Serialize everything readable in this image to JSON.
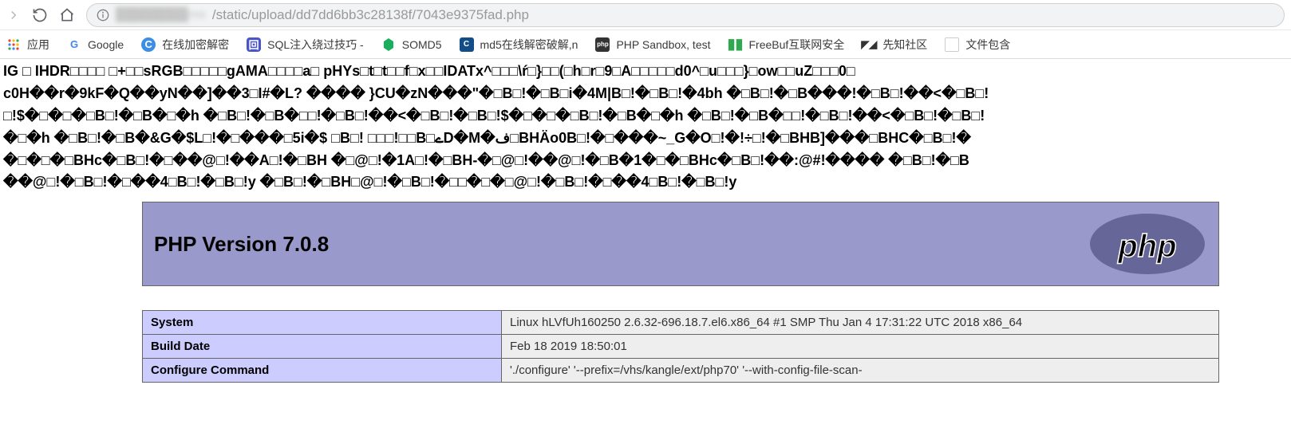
{
  "toolbar": {
    "url_host": "████████me",
    "url_path": "/static/upload/dd7dd6bb3c28138f/7043e9375fad.php"
  },
  "bookmarks": {
    "apps_label": "应用",
    "items": [
      {
        "label": "Google"
      },
      {
        "label": "在线加密解密"
      },
      {
        "label": "SQL注入绕过技巧 -"
      },
      {
        "label": "SOMD5"
      },
      {
        "label": "md5在线解密破解,n"
      },
      {
        "label": "PHP Sandbox, test"
      },
      {
        "label": "FreeBuf互联网安全"
      },
      {
        "label": "先知社区"
      },
      {
        "label": "文件包含"
      }
    ]
  },
  "rawdump": "IG □ IHDR□□□□ □+□□sRGB□□□□□gAMA□□□□a□ pHYs□t□t□□f□x□□IDATx^□□□\\ŕ□}□□(□h□r□9□A□□□□□d0^□u□□□}□ow□□uZ□□□0□\nc0H��r�9kF�Q��yN��]��3□I#�L? ���� }CU�zN���\"�□B□!�□B□i�4M|B□!�□B□!�4bh �□B□!�□B���!�□B□!��<�□B□!\n□!$�□�□�□B□!�□B�□�h �□B□!�□B�□□!�□B□!��<�□B□!�□B□!$�□�□�□B□!�□B�□�h �□B□!�□B�□□!�□B□!��<�□B□!�□B□!\n�□�h �□B□!�□B�&G�$L□!�□���□5i�$ □B□! □□□!□□B□ےD�M�ف□BHÄo0B□!�□���~_G�O□!�!÷□!�□BHB]���□BHC�□B□!�\n�□�□�□BHc�□B□!�□��@□!��A□!�□BH �□@□!�1A□!�□BH-�□@□!��@□!�□B�1�□�□BHc�□B□!��:@#!���� �□B□!�□B\n��@□!�□B□!�□��4□B□!�□B□!y �□B□!�□BH□@□!�□B□!�□□�□�□@□!�□B□!�□��4□B□!�□B□!y",
  "phpinfo": {
    "version_title": "PHP Version 7.0.8",
    "rows": [
      {
        "label": "System",
        "value": "Linux hLVfUh160250 2.6.32-696.18.7.el6.x86_64 #1 SMP Thu Jan 4 17:31:22 UTC 2018 x86_64"
      },
      {
        "label": "Build Date",
        "value": "Feb 18 2019 18:50:01"
      },
      {
        "label": "Configure Command",
        "value": "'./configure' '--prefix=/vhs/kangle/ext/php70' '--with-config-file-scan-"
      }
    ]
  }
}
